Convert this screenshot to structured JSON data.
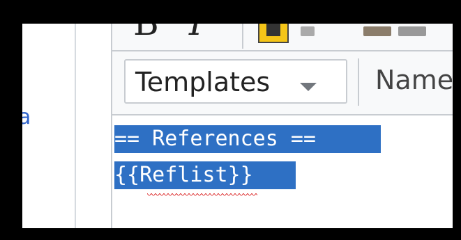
{
  "toolbar": {
    "bold_glyph": "B",
    "italic_glyph": "I",
    "templates_label": "Templates",
    "named_label": "Name"
  },
  "sidebar": {
    "link_letter": "a"
  },
  "editor": {
    "lines": [
      "== References ==",
      "{{Reflist}}"
    ]
  },
  "colors": {
    "selection": "#2e70c4",
    "link": "#3366cc",
    "toolbar_bg": "#f8f9fa",
    "border": "#c8ccd1",
    "spellcheck": "#dd3333"
  },
  "icons": {
    "bold": "bold-icon",
    "italic": "italic-icon",
    "embedded_file": "embedded-file-icon",
    "dropdown": "chevron-down-icon"
  }
}
